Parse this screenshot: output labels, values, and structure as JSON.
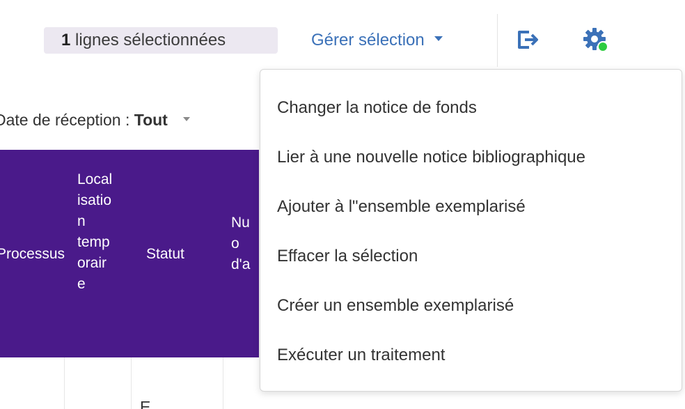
{
  "toolbar": {
    "selection_count": "1",
    "selection_text": "lignes sélectionnées",
    "manage_label": "Gérer sélection",
    "export_icon": "export-icon",
    "settings_icon": "settings-gear-icon",
    "settings_dot_color": "#2ecc40"
  },
  "filter": {
    "label": "Date de réception : ",
    "value": "Tout"
  },
  "table": {
    "header_color": "#4a1a8a",
    "columns": [
      "Processus",
      "Local\nisatio\nn\ntemp\norair\ne",
      "Statut",
      "Nu\no\nd'a"
    ],
    "body_partial_text": "E"
  },
  "menu": {
    "items": [
      "Changer la notice de fonds",
      "Lier à une nouvelle notice bibliographique",
      "Ajouter à l\"ensemble exemplarisé",
      "Effacer la sélection",
      "Créer un ensemble exemplarisé",
      "Exécuter un traitement"
    ]
  }
}
